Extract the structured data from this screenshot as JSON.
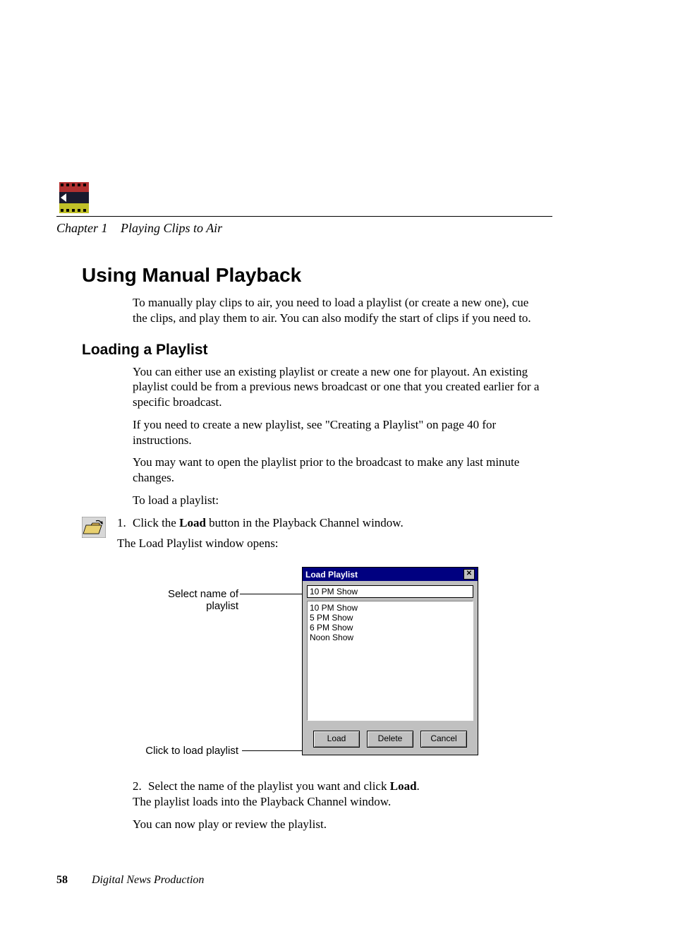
{
  "header": {
    "chapter_label": "Chapter 1",
    "chapter_title": "Playing Clips to Air"
  },
  "section": {
    "title": "Using Manual Playback",
    "intro": "To manually play clips to air, you need to load a playlist (or create a new one), cue the clips, and play them to air. You can also modify the start of clips if you need to."
  },
  "subsection": {
    "title": "Loading a Playlist",
    "p1": "You can either use an existing playlist or create a new one for playout. An existing playlist could be from a previous news broadcast or one that you created earlier for a specific broadcast.",
    "p2": "If you need to create a new playlist, see \"Creating a Playlist\" on page 40 for instructions.",
    "p3": "You may want to open the playlist prior to the broadcast to make any last minute changes.",
    "lead": "To load a playlist:",
    "step1_num": "1.",
    "step1_a": "Click the ",
    "step1_bold": "Load",
    "step1_b": " button in the Playback Channel window.",
    "step1_sub": "The Load Playlist window opens:",
    "callout1": "Select name of playlist",
    "callout2": "Click to load playlist",
    "step2_num": "2.",
    "step2_a": "Select the name of the playlist you want and click ",
    "step2_bold": "Load",
    "step2_b": ".",
    "step2_sub": "The playlist loads into the Playback Channel window.",
    "closing": "You can now play or review the playlist."
  },
  "dialog": {
    "title": "Load Playlist",
    "input_value": "10 PM Show",
    "list": [
      "10 PM Show",
      "5 PM Show",
      "6 PM Show",
      "Noon Show"
    ],
    "btn_load": "Load",
    "btn_delete": "Delete",
    "btn_cancel": "Cancel"
  },
  "footer": {
    "page": "58",
    "title": "Digital News Production"
  }
}
